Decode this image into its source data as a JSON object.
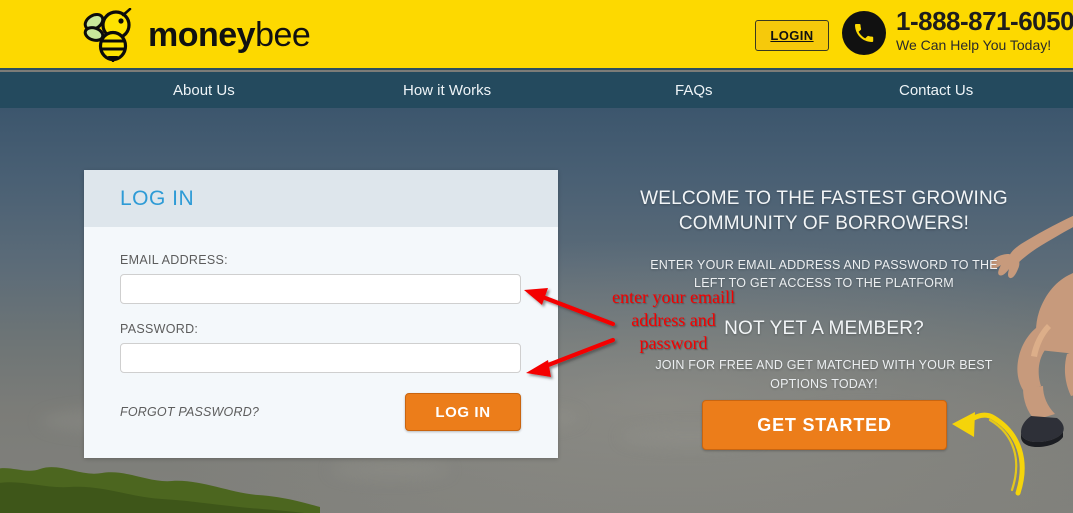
{
  "header": {
    "logo_text_bold": "money",
    "logo_text_light": "bee",
    "logo_icon": "bee-icon",
    "login_button": "LOGIN",
    "phone_icon": "phone-icon",
    "phone_number": "1-888-871-6050",
    "phone_tagline": "We Can Help You Today!"
  },
  "nav": {
    "items": [
      {
        "label": "About Us"
      },
      {
        "label": "How it Works"
      },
      {
        "label": "FAQs"
      },
      {
        "label": "Contact Us"
      }
    ]
  },
  "login_panel": {
    "title": "LOG IN",
    "email_label": "EMAIL ADDRESS:",
    "email_value": "",
    "email_placeholder": "",
    "password_label": "PASSWORD:",
    "password_value": "",
    "password_placeholder": "",
    "forgot_password": "FORGOT PASSWORD?",
    "submit_label": "LOG IN"
  },
  "promo": {
    "headline": "WELCOME TO THE FASTEST GROWING COMMUNITY OF BORROWERS!",
    "subtext": "ENTER YOUR EMAIL ADDRESS AND PASSWORD TO THE LEFT TO GET ACCESS TO THE PLATFORM",
    "headline2": "NOT YET A MEMBER?",
    "subtext2": "JOIN FOR FREE AND GET MATCHED WITH YOUR BEST OPTIONS TODAY!",
    "cta_label": "GET STARTED"
  },
  "annotations": {
    "red_note": "enter your emaill address and password",
    "red_note_color": "#f40000",
    "yellow_arrow_color": "#f5d40a"
  },
  "colors": {
    "header_yellow": "#fdd900",
    "nav_blue": "#244a5e",
    "accent_orange": "#ec7d1a",
    "panel_head": "#dee6ec",
    "panel_title_blue": "#2e9bd6"
  }
}
